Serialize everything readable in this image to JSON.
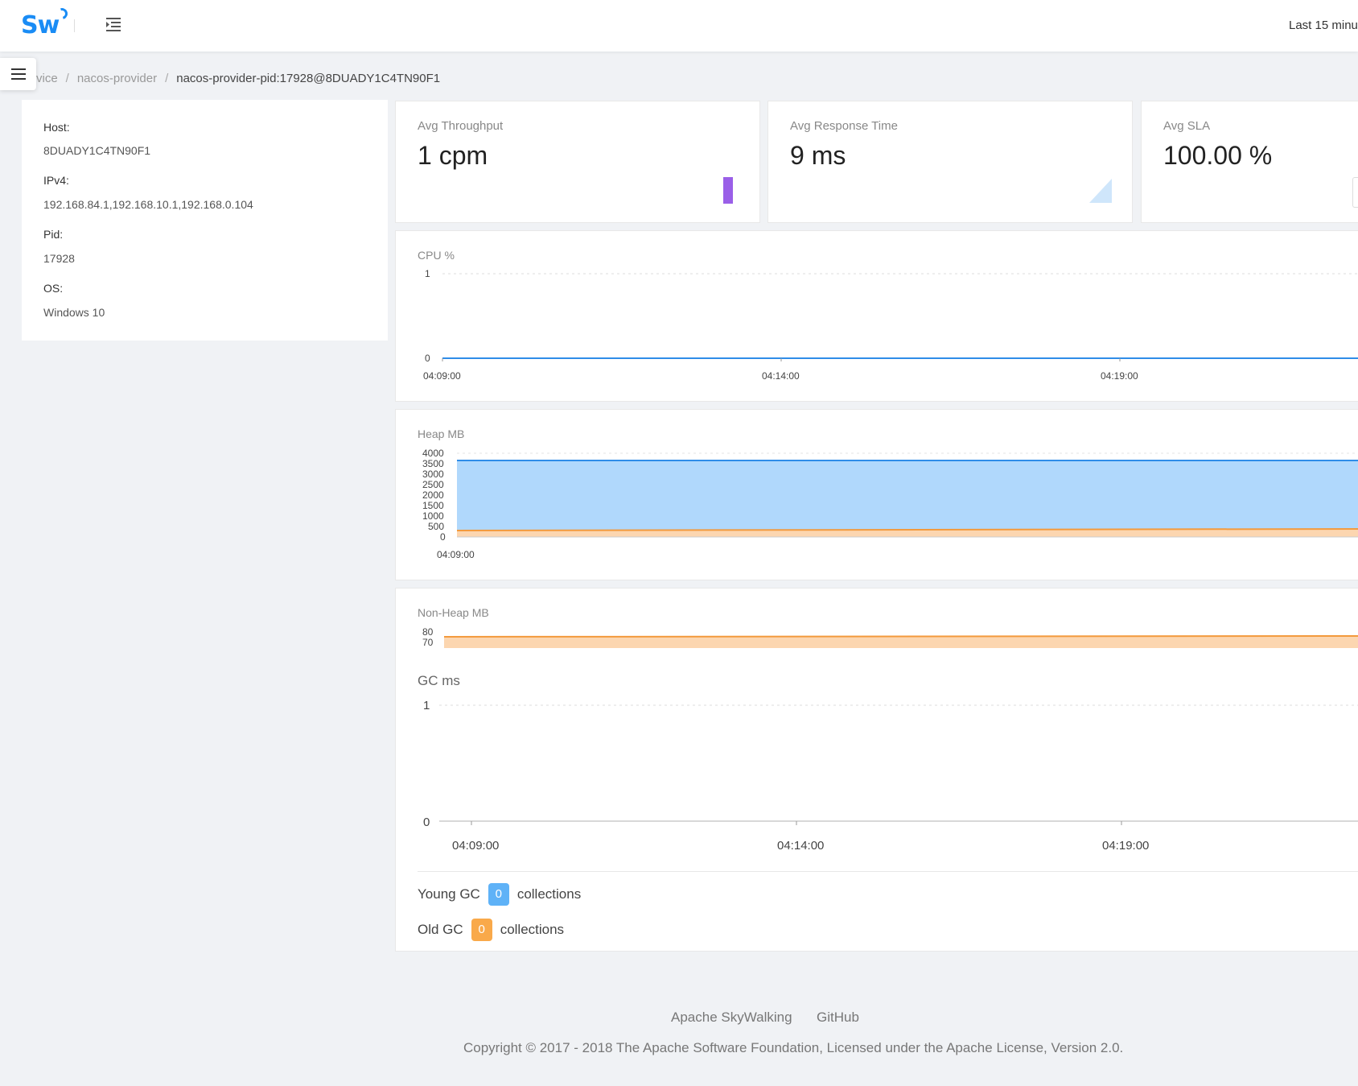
{
  "header": {
    "logo_text": "Sw",
    "time_range": "Last 15 minu"
  },
  "breadcrumb": {
    "items": [
      "rvice",
      "nacos-provider",
      "nacos-provider-pid:17928@8DUADY1C4TN90F1"
    ],
    "separator": "/"
  },
  "instance_info": {
    "host_label": "Host:",
    "host_value": "8DUADY1C4TN90F1",
    "ipv4_label": "IPv4:",
    "ipv4_value": "192.168.84.1,192.168.10.1,192.168.0.104",
    "pid_label": "Pid:",
    "pid_value": "17928",
    "os_label": "OS:",
    "os_value": "Windows 10"
  },
  "stats": {
    "throughput_title": "Avg Throughput",
    "throughput_value": "1 cpm",
    "response_title": "Avg Response Time",
    "response_value": "9 ms",
    "sla_title": "Avg SLA",
    "sla_value": "100.00 %"
  },
  "colors": {
    "accent": "#1a8cf5",
    "heap_area": "#b0d8fc",
    "heap_line": "#2f8de8",
    "nonheap_area": "#fcd6b0",
    "nonheap_line": "#f39a3d",
    "throughput_bar": "#9a5fe8"
  },
  "chart_data": [
    {
      "type": "line",
      "title": "CPU %",
      "x": [
        "04:09:00",
        "04:14:00",
        "04:19:00"
      ],
      "yticks": [
        "1",
        "0"
      ],
      "ylim": [
        0,
        1
      ],
      "series": [
        {
          "values": [
            0,
            0,
            0
          ]
        }
      ],
      "grid": true
    },
    {
      "type": "area",
      "title": "Heap MB",
      "x": [
        "04:09:00"
      ],
      "yticks": [
        "4000",
        "3500",
        "3000",
        "2500",
        "2000",
        "1500",
        "1000",
        "500",
        "0"
      ],
      "ylim": [
        0,
        4000
      ],
      "series": [
        {
          "values": [
            3640,
            3640
          ]
        },
        {
          "values": [
            360,
            380
          ]
        }
      ],
      "grid": true
    },
    {
      "type": "area",
      "title": "Non-Heap MB",
      "yticks": [
        "80",
        "70"
      ],
      "ylim": [
        70,
        80
      ],
      "series": [
        {
          "values": [
            76,
            77
          ]
        }
      ],
      "grid": true
    },
    {
      "type": "line",
      "title": "GC ms",
      "x": [
        "04:09:00",
        "04:14:00",
        "04:19:00"
      ],
      "yticks": [
        "1",
        "0"
      ],
      "ylim": [
        0,
        1
      ],
      "series": [
        {
          "values": [
            0,
            0,
            0
          ]
        }
      ],
      "grid": true
    }
  ],
  "gc": {
    "young_label": "Young GC",
    "young_count": "0",
    "old_label": "Old GC",
    "old_count": "0",
    "unit": "collections"
  },
  "footer": {
    "link_skywalking": "Apache SkyWalking",
    "link_github": "GitHub",
    "copyright": "Copyright © 2017 - 2018 The Apache Software Foundation, Licensed under the Apache License, Version 2.0."
  }
}
